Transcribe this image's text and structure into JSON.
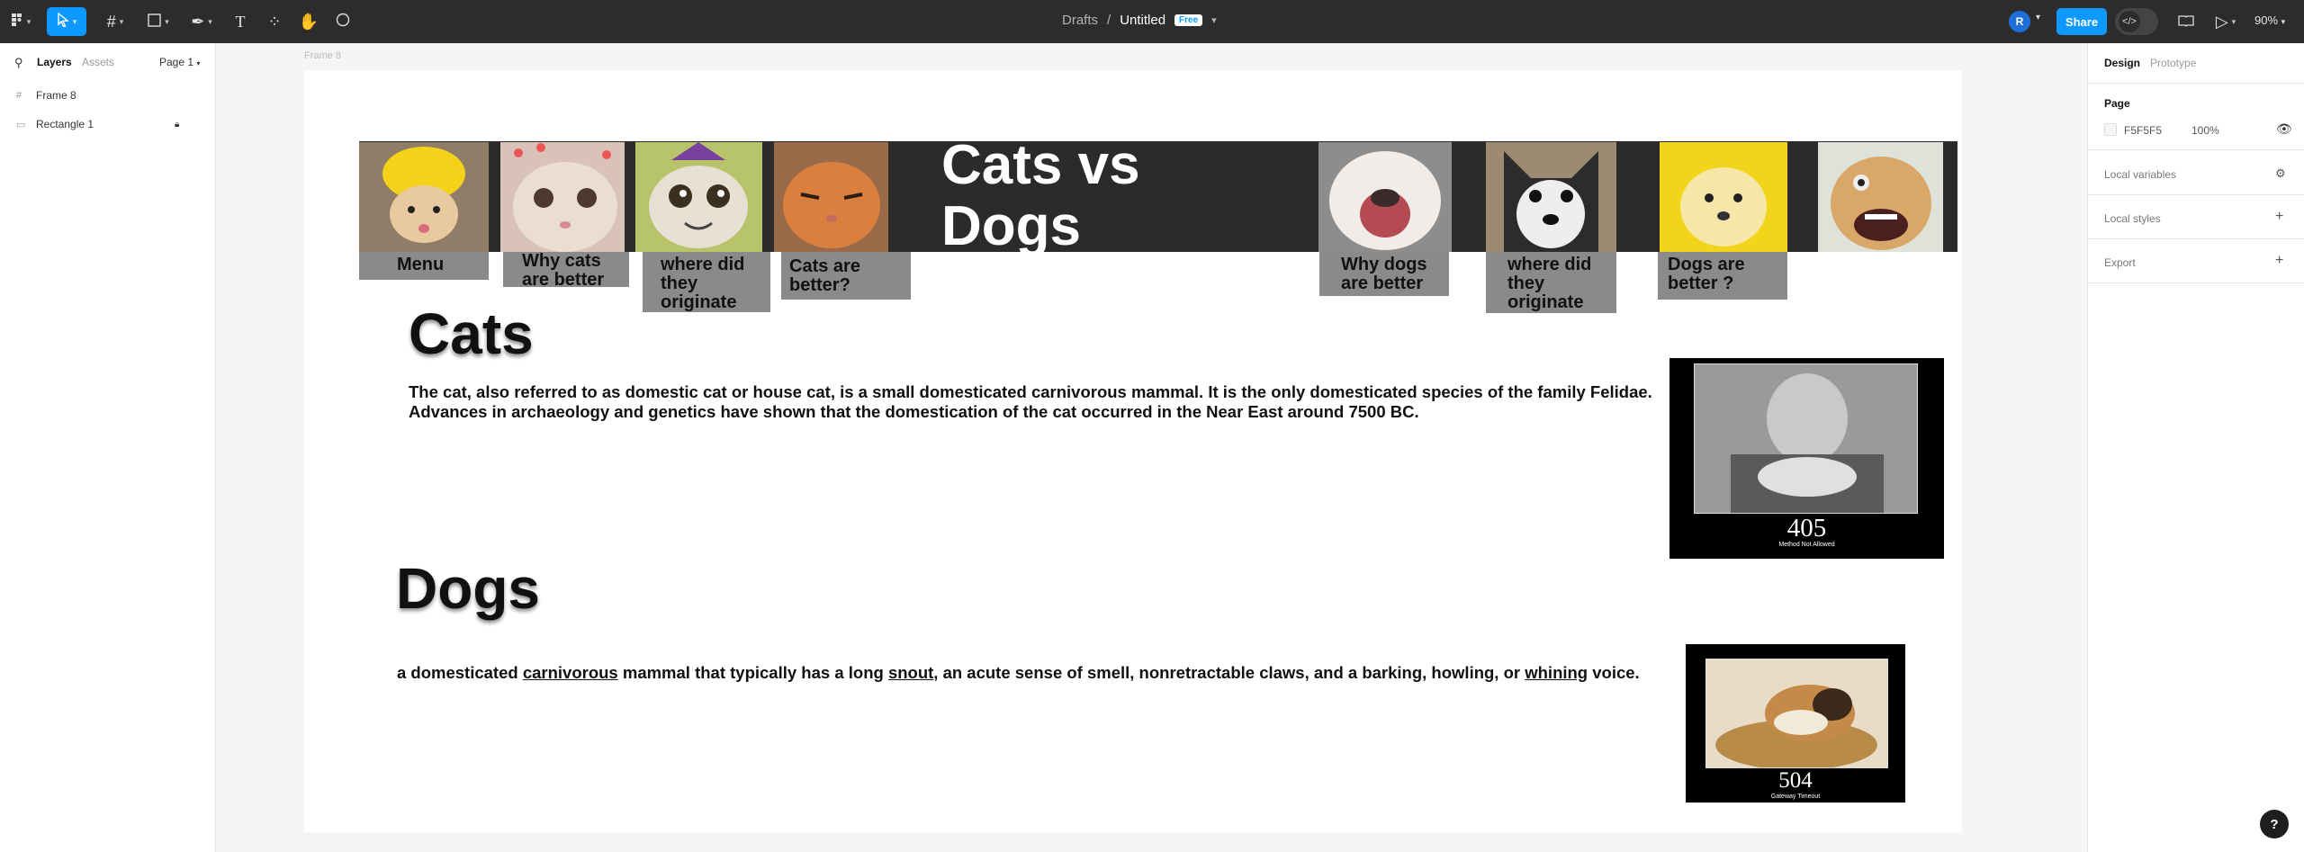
{
  "toolbar": {
    "breadcrumb_folder": "Drafts",
    "breadcrumb_sep": "/",
    "file_name": "Untitled",
    "plan_badge": "Free",
    "avatar_initial": "R",
    "share_label": "Share",
    "zoom": "90%"
  },
  "left_panel": {
    "tab_layers": "Layers",
    "tab_assets": "Assets",
    "page_selector": "Page 1",
    "layers": [
      "Frame 8",
      "Rectangle 1"
    ]
  },
  "canvas": {
    "frame_label": "Frame 8",
    "title": "Cats vs Dogs",
    "nav_cats": [
      "Menu",
      "Why cats are better",
      "where did they originate",
      "Cats are better?"
    ],
    "nav_dogs": [
      "Why dogs are  better",
      "where did they originate",
      "Dogs are better ?"
    ],
    "cats_heading": "Cats",
    "cats_text": "The cat, also referred to as domestic cat or house cat, is a small domesticated carnivorous mammal. It is the only domesticated species of the family Felidae.  Advances in archaeology and genetics have shown that the domestication of the cat occurred in the Near East around 7500 BC.",
    "dogs_heading": "Dogs",
    "dogs_text": {
      "part1": "a domesticated ",
      "link1": "carnivorous",
      "part2": " mammal that typically has a long ",
      "link2": "snout",
      "part3": ", an acute sense of smell, nonretractable claws, and a barking, howling, or ",
      "link3": "whining",
      "part4": " voice."
    },
    "poster1": {
      "code": "405",
      "caption": "Method Not Allowed"
    },
    "poster2": {
      "code": "504",
      "caption": "Gateway Timeout"
    }
  },
  "right_panel": {
    "tab_design": "Design",
    "tab_prototype": "Prototype",
    "page_section": "Page",
    "page_color": "F5F5F5",
    "page_opacity": "100%",
    "local_variables": "Local variables",
    "local_styles": "Local styles",
    "export": "Export"
  },
  "help": "?",
  "colors": {
    "accent": "#0d99ff",
    "toolbar": "#2c2c2c",
    "banner": "#2b2b2b",
    "nav_box": "#8a8a8a"
  }
}
